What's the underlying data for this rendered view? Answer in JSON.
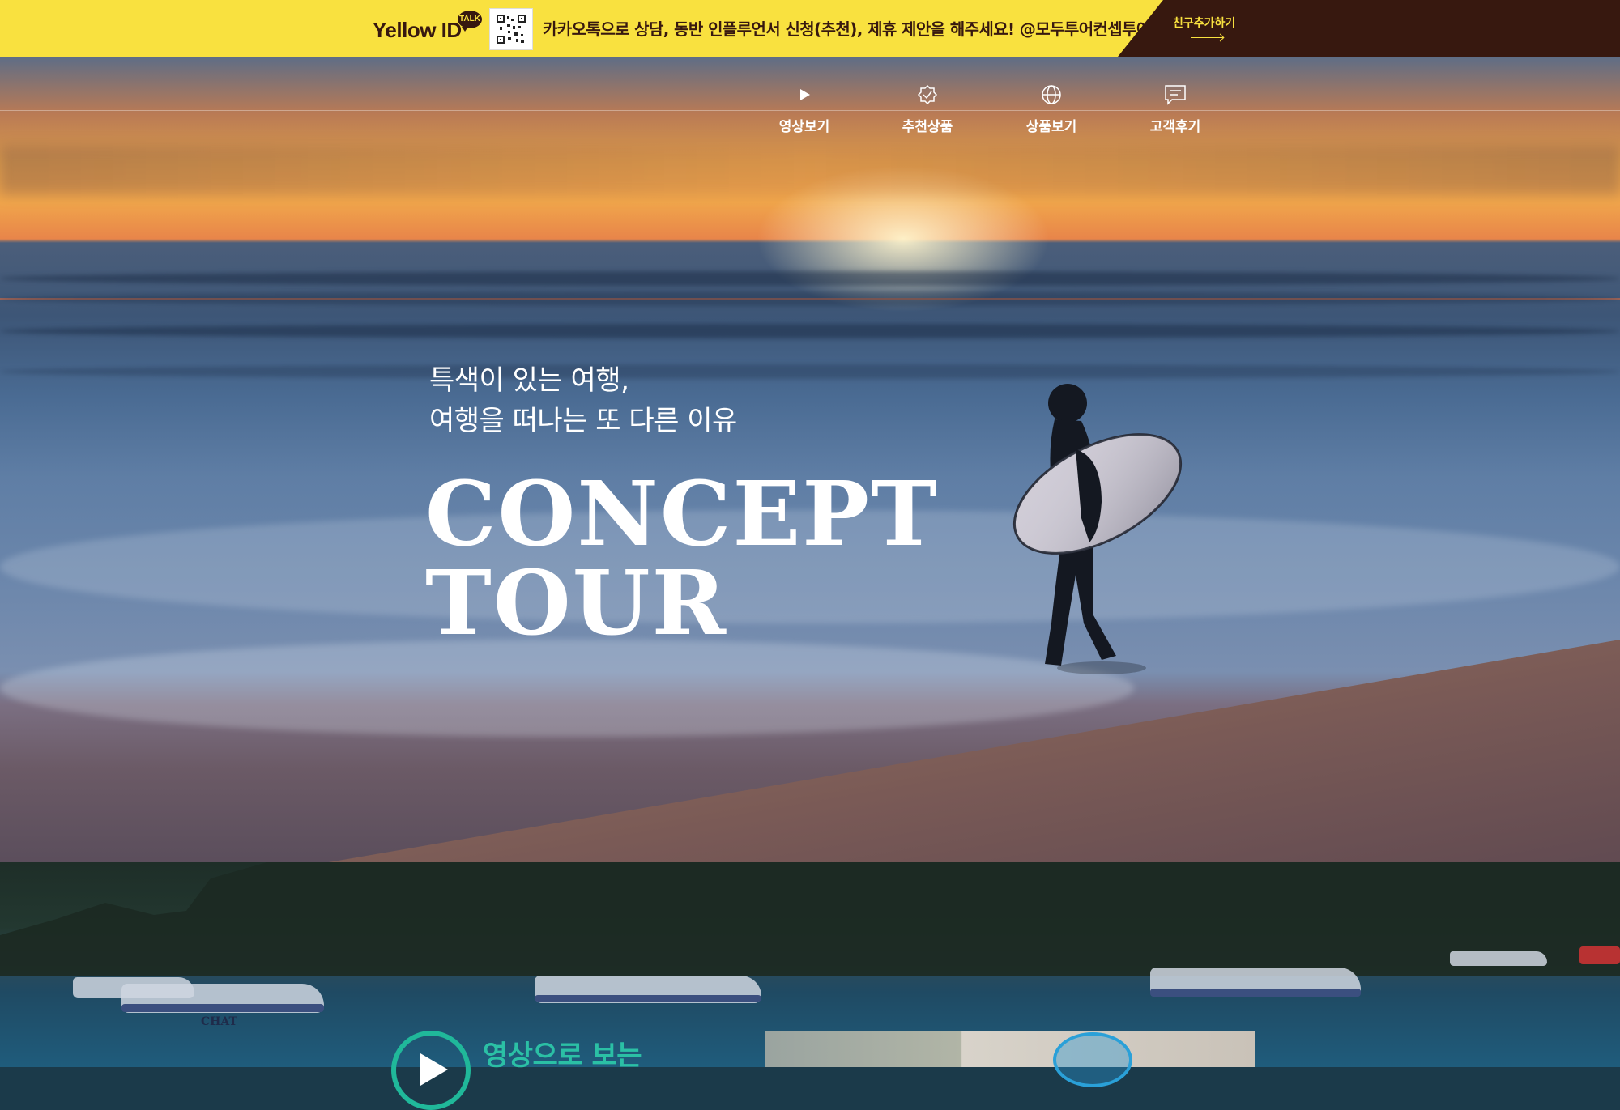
{
  "topbar": {
    "brand": "Yellow ID",
    "badge": "TALK",
    "notice": "카카오톡으로 상담, 동반 인플루언서 신청(추천), 제휴 제안을 해주세요! @모두투어컨셉투어",
    "cta": "친구추가하기",
    "colors": {
      "yellow": "#f9e13f",
      "brown": "#37180f"
    }
  },
  "nav": {
    "items": [
      {
        "label": "영상보기",
        "icon": "play-icon"
      },
      {
        "label": "추천상품",
        "icon": "badge-check-icon"
      },
      {
        "label": "상품보기",
        "icon": "globe-icon"
      },
      {
        "label": "고객후기",
        "icon": "chat-icon"
      }
    ]
  },
  "hero": {
    "slogan_line1": "특색이 있는 여행,",
    "slogan_line2": "여행을 떠나는 또 다른 이유",
    "title_line1": "CONCEPT",
    "title_line2": "TOUR"
  },
  "section2": {
    "title": "영상으로 보는",
    "accent": "#20b89a"
  },
  "boat_label": "CHAT"
}
